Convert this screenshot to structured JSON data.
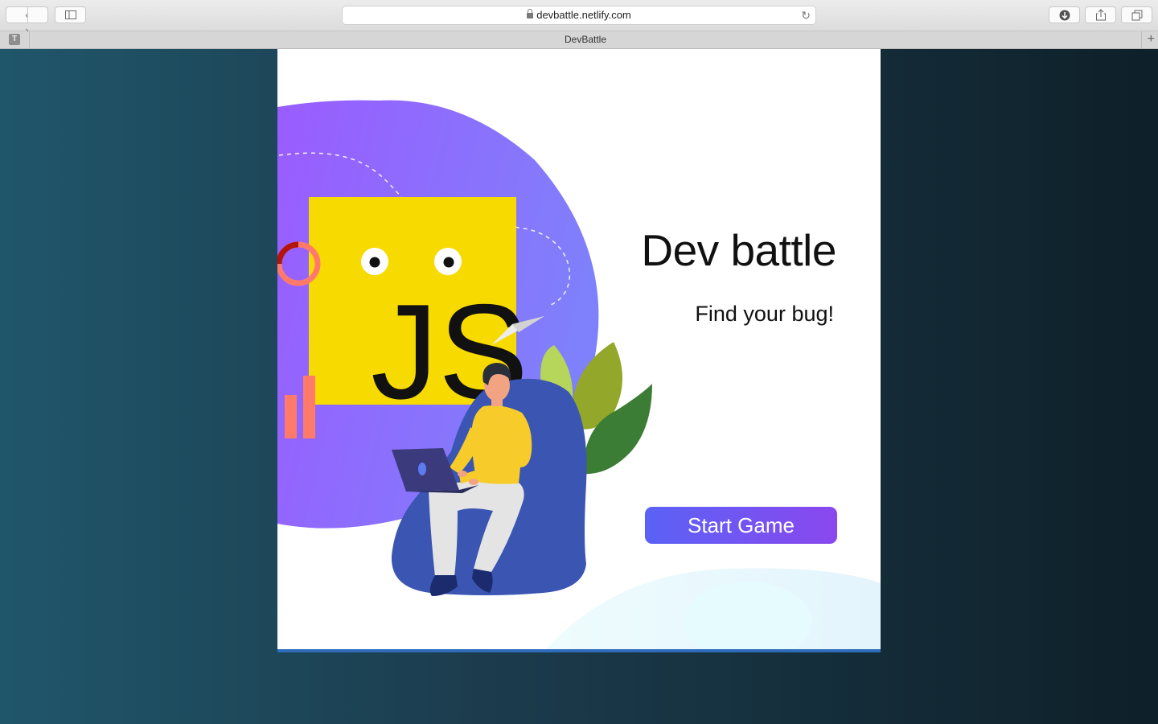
{
  "browser": {
    "url": "devbattle.netlify.com",
    "tab_title": "DevBattle",
    "tab_favicon_letter": "T",
    "icons": [
      "back-icon",
      "forward-icon",
      "sidebar-icon",
      "lock-icon",
      "reload-icon",
      "download-icon",
      "share-icon",
      "tabs-icon",
      "new-tab-icon"
    ]
  },
  "page": {
    "title": "Dev battle",
    "subtitle": "Find your bug!",
    "start_button": "Start Game",
    "illustration_label": "JS"
  },
  "colors": {
    "background_left": "#20566a",
    "background_right": "#0e2029",
    "card": "#ffffff",
    "blob_purple": "#8a6bff",
    "js_yellow": "#f7da00",
    "button_start": "#5a62f6",
    "button_end": "#8a48ee",
    "beanbag_blue": "#3a55b2"
  }
}
